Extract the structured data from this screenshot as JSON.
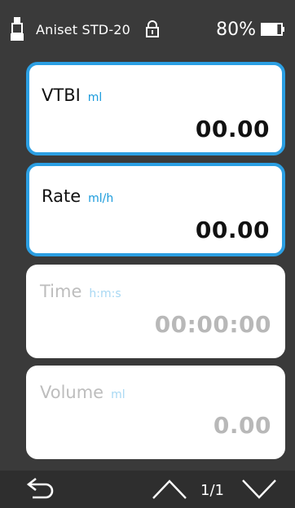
{
  "status": {
    "device_icon": "syringe-pump-icon",
    "device_name": "Aniset STD-20",
    "lock_icon": "lock-icon",
    "battery_percent": "80%",
    "battery_level": 0.8
  },
  "fields": [
    {
      "label": "VTBI",
      "unit": "ml",
      "value": "00.00",
      "state": "active"
    },
    {
      "label": "Rate",
      "unit": "ml/h",
      "value": "00.00",
      "state": "active"
    },
    {
      "label": "Time",
      "unit": "h:m:s",
      "value": "00:00:00",
      "state": "disabled"
    },
    {
      "label": "Volume",
      "unit": "ml",
      "value": "0.00",
      "state": "disabled"
    }
  ],
  "nav": {
    "back_icon": "back-arrow-icon",
    "up_icon": "chevron-up-icon",
    "page": "1/1",
    "down_icon": "chevron-down-icon"
  },
  "colors": {
    "accent": "#2b9fe3",
    "background": "#3a3a3a",
    "bottom_bar": "#2e2e2e"
  }
}
